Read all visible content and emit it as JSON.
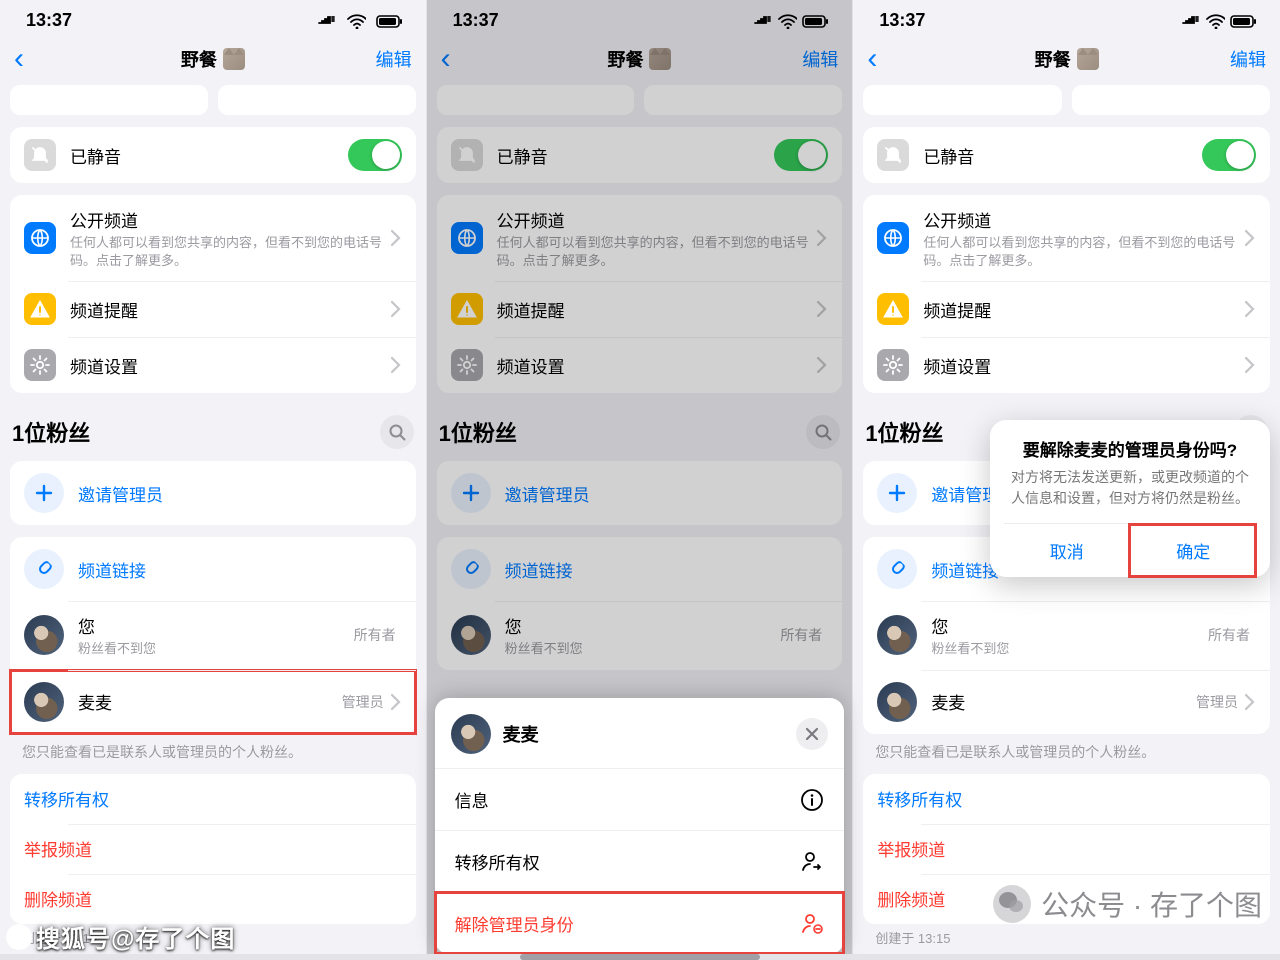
{
  "status": {
    "time": "13:37"
  },
  "nav": {
    "title": "野餐",
    "edit": "编辑"
  },
  "segments": [
    "...",
    "..."
  ],
  "mute": {
    "label": "已静音",
    "on": true
  },
  "public": {
    "title": "公开频道",
    "subtitle": "任何人都可以看到您共享的内容，但看不到您的电话号码。点击了解更多。"
  },
  "reminder": "频道提醒",
  "settings": "频道设置",
  "followers": {
    "title": "1位粉丝"
  },
  "invite": "邀请管理员",
  "channel_link": "频道链接",
  "you": {
    "name": "您",
    "note": "粉丝看不到您",
    "role": "所有者"
  },
  "admin": {
    "name": "麦麦",
    "role": "管理员"
  },
  "only_note": "您只能查看已是联系人或管理员的个人粉丝。",
  "actions": {
    "transfer": "转移所有权",
    "report": "举报频道",
    "delete": "删除频道"
  },
  "created": "创建于 13:15",
  "sheet": {
    "name": "麦麦",
    "info": "信息",
    "transfer": "转移所有权",
    "revoke": "解除管理员身份"
  },
  "popover": {
    "title": "要解除麦麦的管理员身份吗?",
    "body": "对方将无法发送更新，或更改频道的个人信息和设置，但对方将仍然是粉丝。",
    "cancel": "取消",
    "ok": "确定"
  },
  "watermark": {
    "left": "搜狐号@存了个图",
    "right": "公众号 · 存了个图"
  }
}
